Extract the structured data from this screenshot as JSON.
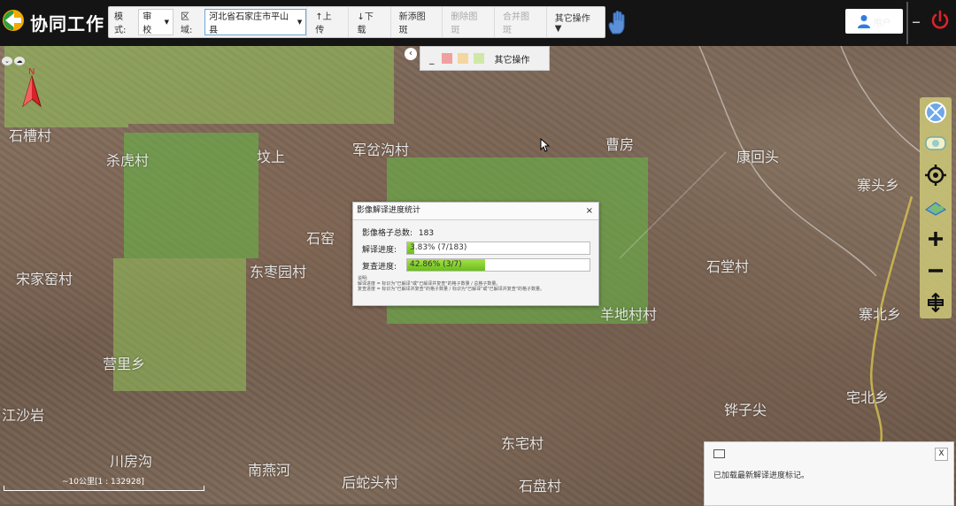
{
  "app": {
    "title": "协同工作"
  },
  "toolbar": {
    "mode_label": "模式:",
    "mode_value": "审校",
    "region_label": "区域:",
    "region_value": "河北省石家庄市平山县",
    "upload": "↑上传",
    "download": "↓下载",
    "add_grid": "新添图斑",
    "delete_grid": "删除图斑",
    "merge_grid": "合并图斑",
    "more_ops": "其它操作▼"
  },
  "header": {
    "user_name": "用户"
  },
  "map": {
    "subbar": {
      "dash": "_",
      "more": "其它操作",
      "swatches": [
        "#f0a0a0",
        "#f4d6a0",
        "#cfe8a8"
      ]
    },
    "collapse": "‹",
    "places": [
      "石槽村",
      "杀虎村",
      "宋家窑村",
      "东枣园村",
      "营里乡",
      "江沙岩",
      "川房沟",
      "南燕河",
      "后蛇头村",
      "曹房",
      "康回头",
      "寨头乡",
      "石堂村",
      "寨北乡",
      "宅北乡",
      "铧子尖",
      "东宅村",
      "羊地村村",
      "军岔沟村",
      "石窑",
      "坟上",
      "石盘村"
    ],
    "scale_text": "~10公里[1 : 132928]"
  },
  "dialog": {
    "title": "影像解译进度统计",
    "close": "×",
    "total_label": "影像格子总数:",
    "total_value": "183",
    "interpret_label": "解译进度:",
    "interpret_text": "3.83%  (7/183)",
    "interpret_fraction": 0.0383,
    "review_label": "复查进度:",
    "review_text": "42.86%  (3/7)",
    "review_fraction": 0.4286,
    "note_title": "说明:",
    "note_1": "解译进度 = 标识为\"已解译\"或\"已解译并复查\"的格子数量 / 总格子数量。",
    "note_2": "复查进度 = 标识为\"已解译并复查\"的格子数量 / 标识为\"已解译\"或\"已解译并复查\"的格子数量。"
  },
  "notify": {
    "message": "已加载最新解译进度标记。",
    "close": "X"
  }
}
